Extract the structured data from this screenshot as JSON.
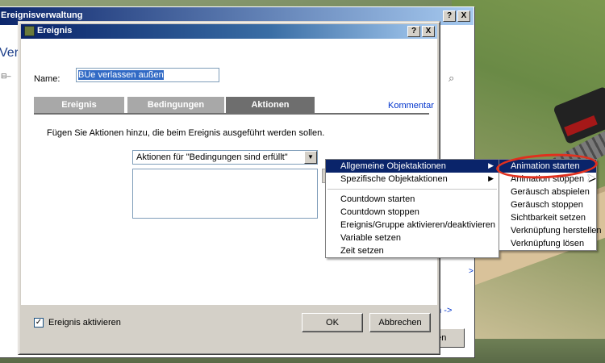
{
  "background_window": {
    "title": "Ereignisverwaltung",
    "side_text": "Verw",
    "link_right": "en ->",
    "link_small": ">",
    "close_label": "hen"
  },
  "dialog": {
    "title": "Ereignis",
    "help_btn": "?",
    "close_btn": "X",
    "name_label": "Name:",
    "name_value": "BUe verlassen außen",
    "tabs": [
      {
        "label": "Ereignis"
      },
      {
        "label": "Bedingungen"
      },
      {
        "label": "Aktionen"
      }
    ],
    "active_tab": "Aktionen",
    "kommentar": "Kommentar",
    "hint": "Fügen Sie Aktionen hinzu, die beim Ereignis ausgeführt werden sollen.",
    "select_value": "Aktionen für \"Bedingungen sind erfüllt\"",
    "checkbox_label": "Ereignis aktivieren",
    "checkbox_checked": true,
    "ok_label": "OK",
    "cancel_label": "Abbrechen"
  },
  "context_menu": {
    "items": [
      {
        "label": "Allgemeine Objektaktionen",
        "submenu": true,
        "highlighted": true
      },
      {
        "label": "Spezifische Objektaktionen",
        "submenu": true,
        "highlighted": false
      },
      {
        "label": "Countdown starten"
      },
      {
        "label": "Countdown stoppen"
      },
      {
        "label": "Ereignis/Gruppe aktivieren/deaktivieren"
      },
      {
        "label": "Variable setzen"
      },
      {
        "label": "Zeit setzen"
      }
    ]
  },
  "submenu": {
    "items": [
      {
        "label": "Animation starten",
        "highlighted": true
      },
      {
        "label": "Animation stoppen"
      },
      {
        "label": "Geräusch abspielen"
      },
      {
        "label": "Geräusch stoppen"
      },
      {
        "label": "Sichtbarkeit setzen"
      },
      {
        "label": "Verknüpfung herstellen"
      },
      {
        "label": "Verknüpfung lösen"
      }
    ]
  },
  "colors": {
    "titlebar": "#0a246a",
    "highlight": "#0a246a",
    "annotation_circle": "#e0301e",
    "link": "#0033cc"
  }
}
